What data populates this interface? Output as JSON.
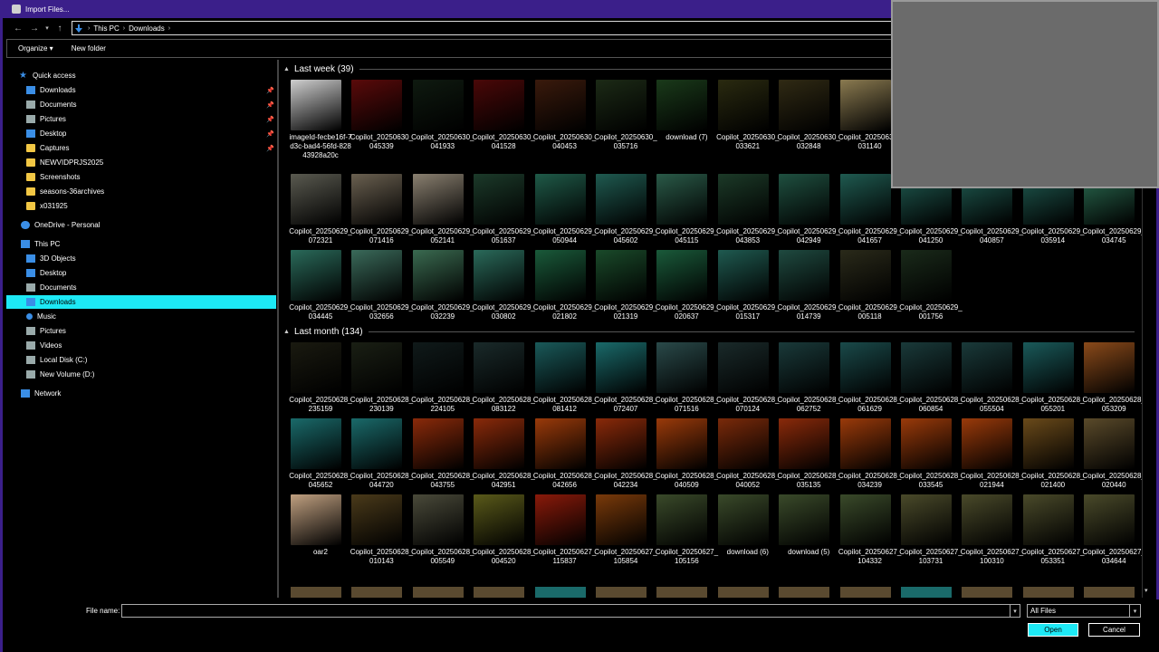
{
  "window": {
    "title": "Import Files..."
  },
  "address": {
    "crumbs": [
      "This PC",
      "Downloads"
    ]
  },
  "commands": {
    "organize": "Organize ▾",
    "new_folder": "New folder"
  },
  "sidebar": {
    "quick_access": "Quick access",
    "quick_items": [
      "Downloads",
      "Documents",
      "Pictures",
      "Desktop",
      "Captures",
      "NEWVIDPRJS2025",
      "Screenshots",
      "seasons-36archives",
      "x031925"
    ],
    "onedrive": "OneDrive - Personal",
    "this_pc": "This PC",
    "pc_items": [
      "3D Objects",
      "Desktop",
      "Documents",
      "Downloads",
      "Music",
      "Pictures",
      "Videos",
      "Local Disk (C:)",
      "New Volume (D:)"
    ],
    "network": "Network"
  },
  "groups": {
    "last_week": "Last week (39)",
    "last_month": "Last month (134)"
  },
  "files_week_row1": [
    "imageId-fecbe16f-7d3c-bad4-56fd-82843928a20c",
    "Copilot_20250630_045339",
    "Copilot_20250630_041933",
    "Copilot_20250630_041528",
    "Copilot_20250630_040453",
    "Copilot_20250630_035716",
    "download (7)",
    "Copilot_20250630_033621",
    "Copilot_20250630_032848",
    "Copilot_20250630_031140"
  ],
  "files_week_row2": [
    "Copilot_20250629_072321",
    "Copilot_20250629_071416",
    "Copilot_20250629_052141",
    "Copilot_20250629_051637",
    "Copilot_20250629_050944",
    "Copilot_20250629_045602",
    "Copilot_20250629_045115",
    "Copilot_20250629_043853",
    "Copilot_20250629_042949",
    "Copilot_20250629_041657",
    "Copilot_20250629_041250",
    "Copilot_20250629_040857",
    "Copilot_20250629_035914",
    "Copilot_20250629_034745"
  ],
  "files_week_row3": [
    "Copilot_20250629_034445",
    "Copilot_20250629_032656",
    "Copilot_20250629_032239",
    "Copilot_20250629_030802",
    "Copilot_20250629_021802",
    "Copilot_20250629_021319",
    "Copilot_20250629_020637",
    "Copilot_20250629_015317",
    "Copilot_20250629_014739",
    "Copilot_20250629_005118",
    "Copilot_20250629_001756"
  ],
  "files_month_row1": [
    "Copilot_20250628_235159",
    "Copilot_20250628_230139",
    "Copilot_20250628_224105",
    "Copilot_20250628_083122",
    "Copilot_20250628_081412",
    "Copilot_20250628_072407",
    "Copilot_20250628_071516",
    "Copilot_20250628_070124",
    "Copilot_20250628_062752",
    "Copilot_20250628_061629",
    "Copilot_20250628_060854",
    "Copilot_20250628_055504",
    "Copilot_20250628_055201",
    "Copilot_20250628_053209"
  ],
  "files_month_row2": [
    "Copilot_20250628_045652",
    "Copilot_20250628_044720",
    "Copilot_20250628_043755",
    "Copilot_20250628_042951",
    "Copilot_20250628_042656",
    "Copilot_20250628_042234",
    "Copilot_20250628_040509",
    "Copilot_20250628_040052",
    "Copilot_20250628_035135",
    "Copilot_20250628_034239",
    "Copilot_20250628_033545",
    "Copilot_20250628_021944",
    "Copilot_20250628_021400",
    "Copilot_20250628_020440"
  ],
  "files_month_row3": [
    "oar2",
    "Copilot_20250628_010143",
    "Copilot_20250628_005549",
    "Copilot_20250628_004520",
    "Copilot_20250627_115837",
    "Copilot_20250627_105854",
    "Copilot_20250627_105156",
    "download (6)",
    "download (5)",
    "Copilot_20250627_104332",
    "Copilot_20250627_103731",
    "Copilot_20250627_100310",
    "Copilot_20250627_053351",
    "Copilot_20250627_034644"
  ],
  "bottom": {
    "file_name_label": "File name:",
    "file_name_value": "",
    "filter": "All Files",
    "open": "Open",
    "cancel": "Cancel"
  },
  "colors": {
    "accent": "#1de9f5",
    "title_bar": "#3b1f8a"
  }
}
